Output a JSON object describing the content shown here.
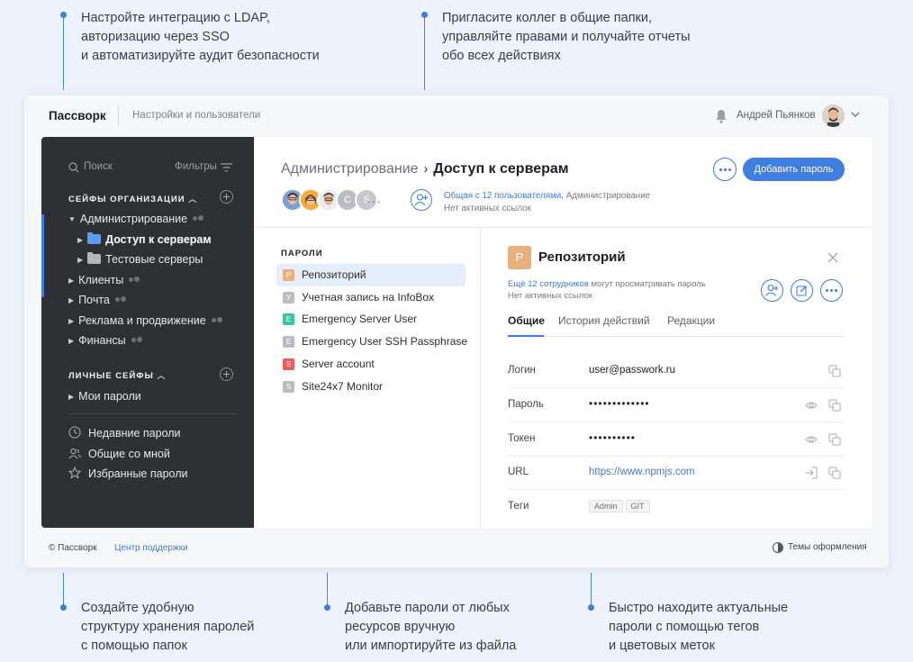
{
  "callouts": {
    "top_left": "Настройте интеграцию с LDAP,\nавторизацию через SSO\nи автоматизируйте аудит безопасности",
    "top_right": "Пригласите коллег в общие папки,\nуправляйте правами и получайте отчеты\nобо всех действиях",
    "bottom_left": "Создайте удобную\nструктуру хранения паролей\nс помощью папок",
    "bottom_mid": "Добавьте пароли от любых\nресурсов вручную\nили импортируйте из файла",
    "bottom_right": "Быстро находите актуальные\nпароли с помощью тегов\nи цветовых меток"
  },
  "topbar": {
    "brand": "Пассворк",
    "section": "Настройки и пользователи",
    "user_name": "Андрей Пьянков"
  },
  "sidebar": {
    "search_placeholder": "Поиск",
    "filters_label": "Фильтры",
    "org_section": "СЕЙФЫ ОРГАНИЗАЦИИ",
    "personal_section": "ЛИЧНЫЕ СЕЙФЫ",
    "org_items": [
      {
        "label": "Администрирование"
      },
      {
        "label": "Доступ к серверам"
      },
      {
        "label": "Тестовые серверы"
      },
      {
        "label": "Клиенты"
      },
      {
        "label": "Почта"
      },
      {
        "label": "Реклама и продвижение"
      },
      {
        "label": "Финансы"
      }
    ],
    "personal_items": [
      {
        "label": "Мои пароли"
      }
    ],
    "bottom_items": [
      {
        "label": "Недавние пароли",
        "icon": "clock-icon"
      },
      {
        "label": "Общие со мной",
        "icon": "people-icon"
      },
      {
        "label": "Избранные пароли",
        "icon": "star-icon"
      }
    ]
  },
  "header": {
    "crumb_parent": "Администрирование",
    "crumb_current": "Доступ к серверам",
    "add_button": "Добавить пароль",
    "share_link": "Общая с 12 пользователями",
    "share_rest": ", Администрирование",
    "links_status": "Нет активных ссылок",
    "avatar_letters": [
      "C",
      "S"
    ]
  },
  "passwords": {
    "title": "ПАРОЛИ",
    "items": [
      {
        "badge": "P",
        "label": "Репозиторий",
        "color": "#eab07c"
      },
      {
        "badge": "У",
        "label": "Учетная запись на InfoBox",
        "color": "#b9bcc2"
      },
      {
        "badge": "E",
        "label": "Emergency Server User",
        "color": "#3ec3a0"
      },
      {
        "badge": "E",
        "label": "Emergency User SSH Passphrase",
        "color": "#b9bcc2"
      },
      {
        "badge": "S",
        "label": "Server account",
        "color": "#ef5a5a"
      },
      {
        "badge": "S",
        "label": "Site24x7 Monitor",
        "color": "#b9bcc2"
      }
    ]
  },
  "detail": {
    "badge": "P",
    "title": "Репозиторий",
    "viewers_link": "Ещё 12 сотрудников",
    "viewers_rest": " могут просматривать пароль",
    "links_status": "Нет активных ссылок",
    "tabs": [
      "Общие",
      "История действий",
      "Редакции"
    ],
    "fields": {
      "login_label": "Логин",
      "login_value": "user@passwork.ru",
      "password_label": "Пароль",
      "password_value": "•••••••••••••",
      "token_label": "Токен",
      "token_value": "••••••••••",
      "url_label": "URL",
      "url_value": "https://www.npmjs.com",
      "tags_label": "Теги",
      "tags": [
        "Admin",
        "GIT"
      ]
    }
  },
  "footer": {
    "copyright": "© Пассворк",
    "support": "Центр поддержки",
    "theme": "Темы оформления"
  },
  "colors": {
    "accent": "#3f7fe2",
    "sidebar_bg": "#2e3033",
    "page_bg": "#edf2fb"
  }
}
